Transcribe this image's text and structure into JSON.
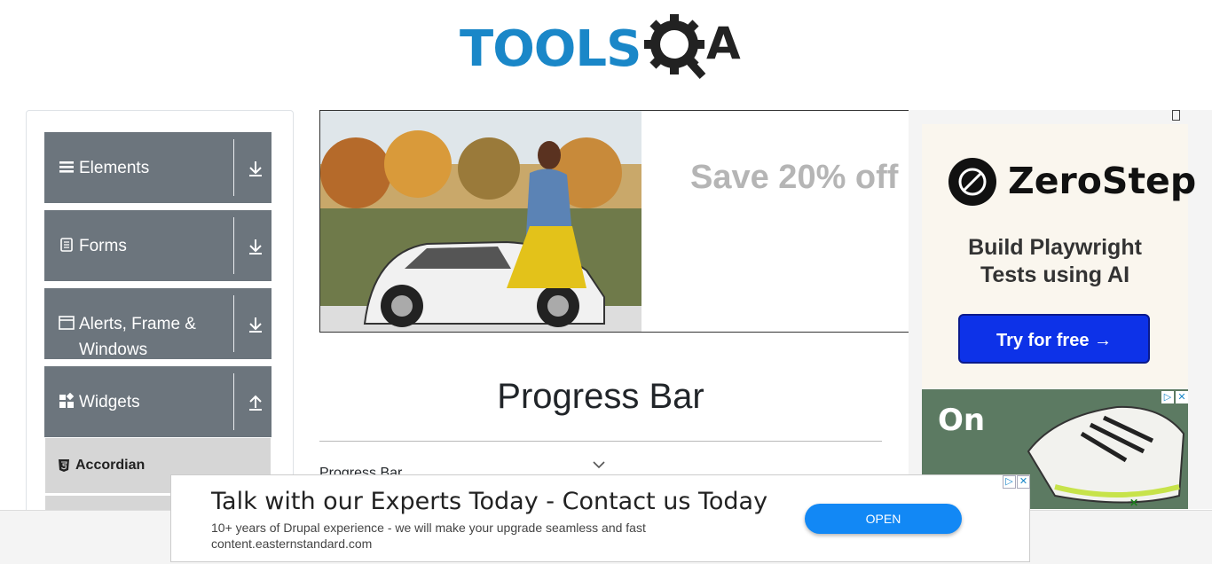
{
  "brand": {
    "text_tools": "TOOLS",
    "text_qa": "A"
  },
  "sidebar": {
    "groups": [
      {
        "label": "Elements",
        "icon": "hamburger-icon",
        "chevron": "download-arrow-icon"
      },
      {
        "label": "Forms",
        "icon": "document-icon",
        "chevron": "download-arrow-icon"
      },
      {
        "label": "Alerts, Frame & Windows",
        "icon": "window-icon",
        "chevron": "download-arrow-icon"
      },
      {
        "label": "Widgets",
        "icon": "widgets-icon",
        "chevron": "upload-arrow-icon"
      }
    ],
    "active_item": {
      "label": "Accordian",
      "icon": "html5-icon"
    }
  },
  "banner": {
    "promo_text": "Save 20% off"
  },
  "main": {
    "title": "Progress Bar",
    "section_label": "Progress Bar"
  },
  "right_ad": {
    "brand": "ZeroStep",
    "tagline_line1": "Build Playwright",
    "tagline_line2": "Tests using AI",
    "cta": "Try for free →",
    "shoe_logo": "On"
  },
  "bottom_ad": {
    "headline": "Talk with our Experts Today - Contact us Today",
    "description": "10+ years of Drupal experience - we will make your upgrade seamless and fast",
    "url": "content.easternstandard.com",
    "button": "OPEN"
  },
  "colors": {
    "brand_blue": "#1a87c8",
    "sidebar_group": "#6c757d",
    "open_button": "#1288f5",
    "cta_blue": "#0d32e8"
  }
}
